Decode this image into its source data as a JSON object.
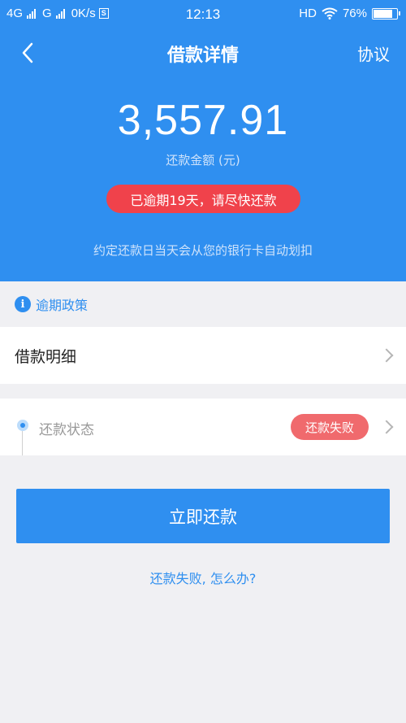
{
  "status_bar": {
    "signal1": "4G",
    "signal2": "G",
    "speed": "0K/s",
    "sim": "S",
    "time": "12:13",
    "hd": "HD",
    "battery": "76%",
    "battery_level": 0.76
  },
  "nav": {
    "title": "借款详情",
    "protocol": "协议",
    "back_icon": "chevron-left-icon"
  },
  "summary": {
    "amount": "3,557.91",
    "amount_label": "还款金额 (元)",
    "overdue_notice": "已逾期19天，请尽快还款",
    "auto_debit_note": "约定还款日当天会从您的银行卡自动划扣"
  },
  "policy": {
    "label": "逾期政策",
    "icon": "info-icon"
  },
  "detail": {
    "label": "借款明细"
  },
  "status": {
    "label": "还款状态",
    "badge": "还款失败"
  },
  "actions": {
    "repay_label": "立即还款",
    "help_link": "还款失败, 怎么办?"
  },
  "colors": {
    "primary": "#2f8ff0",
    "overdue_red": "#f0424b",
    "fail_red": "#f06a6d",
    "background": "#f0f0f3"
  }
}
